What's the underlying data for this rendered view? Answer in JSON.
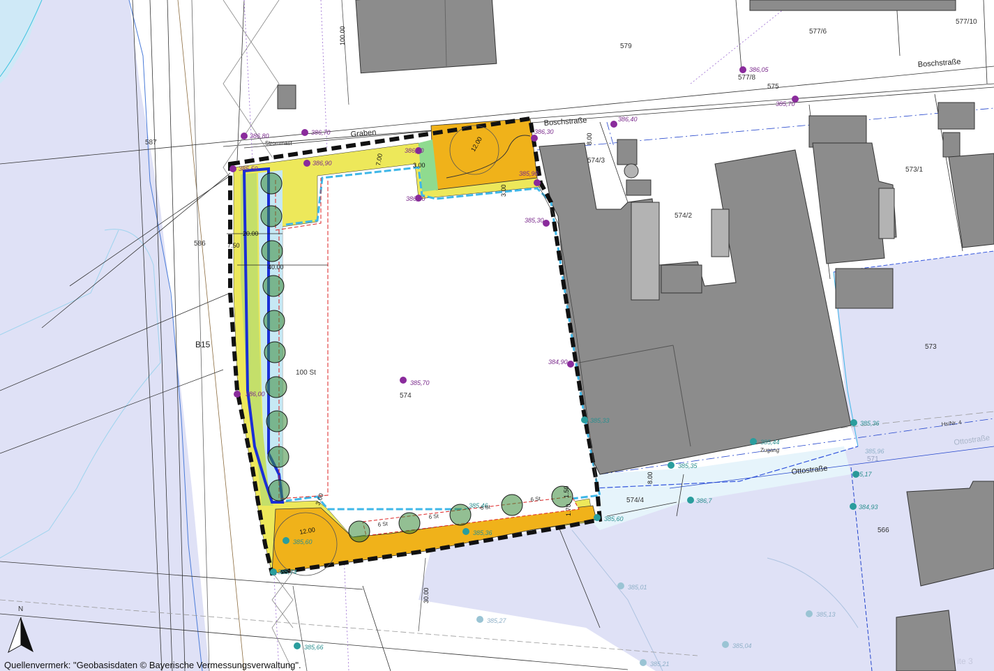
{
  "colors": {
    "building": "#8c8c8c",
    "building_light": "#b3b3b3",
    "floodplain": "#dfe1f6",
    "floodplain_line": "#2244cc",
    "site_border": "#111111",
    "green_strip": "#ede85a",
    "orange_area": "#f0b21a",
    "blue_channel": "#1a2fd6",
    "cyan_line": "#3fb7e8",
    "red_dash": "#dd2222",
    "tree": "#3b8a3b",
    "marker_purple": "#8a2b9c",
    "marker_teal": "#2a9d9d"
  },
  "streets": {
    "boschstrasse_top": "Boschstraße",
    "boschstrasse_mid": "Boschstraße",
    "ottostrasse": "Ottostraße",
    "ottostrasse_faded": "Ottostraße",
    "graben": "Graben",
    "b15": "B15",
    "strommast": "Strommast"
  },
  "parcels": {
    "p579": "579",
    "p577_6": "577/6",
    "p577_10": "577/10",
    "p577_8": "577/8",
    "p575": "575",
    "p587": "587",
    "p586": "586",
    "p574_3": "574/3",
    "p573_1": "573/1",
    "p574_2": "574/2",
    "p573": "573",
    "p574": "574",
    "p574_4": "574/4",
    "p571": "571",
    "p566": "566"
  },
  "labels": {
    "parking_100": "100 St",
    "parking_6a": "6 St",
    "parking_6b": "6 St",
    "parking_6c": "6 St",
    "parking_6d": "6 St",
    "zugang": "Zugang",
    "hausnr": "Hs/Nr. 4",
    "seite": "ite 3"
  },
  "dimensions": {
    "d100": "100.00",
    "d30": "30.00",
    "d40": "40.00",
    "d20": "20.00",
    "d750": "7.50",
    "d300a": "3.00",
    "d300b": "3.00",
    "d300c": "3.00",
    "d800a": "8.00",
    "d800b": "8.00",
    "d1200a": "12.00",
    "d1200b": "12.00",
    "d700": "7.00",
    "d170": "1.70",
    "d150": "1.50"
  },
  "elevations": {
    "e38680": "386,80",
    "e38650": "385,50",
    "e38670": "386,70",
    "e38690": "386,90",
    "e38630": "386,30",
    "e38640": "386,40",
    "e38560": "385,90",
    "e38650b": "386,50",
    "e38530": "385,30",
    "e38490": "384,90",
    "e38570": "385,70",
    "e38570b": "385,70",
    "e38580": "386,80",
    "e38600": "386,00",
    "e38533": "385,33",
    "e38536": "385,36",
    "e38544": "385,44",
    "e38535": "385,35",
    "e38596": "385,96",
    "e38517": "385,17",
    "e38493": "384,93",
    "e38560b": "385,60",
    "e38546": "385,46",
    "e38536b": "385,36",
    "e38560c": "385,60",
    "e38574": "385,74",
    "e38566": "385,66",
    "e38501": "385,01",
    "e38527": "385,27",
    "e38513": "385,13",
    "e38504": "385,04",
    "e38521": "385,21",
    "e38605": "386,05",
    "e38670c": "386,7"
  },
  "north_arrow": "N",
  "source_note": "Quellenvermerk: \"Geobasisdaten © Bayerische Vermessungsverwaltung\"."
}
